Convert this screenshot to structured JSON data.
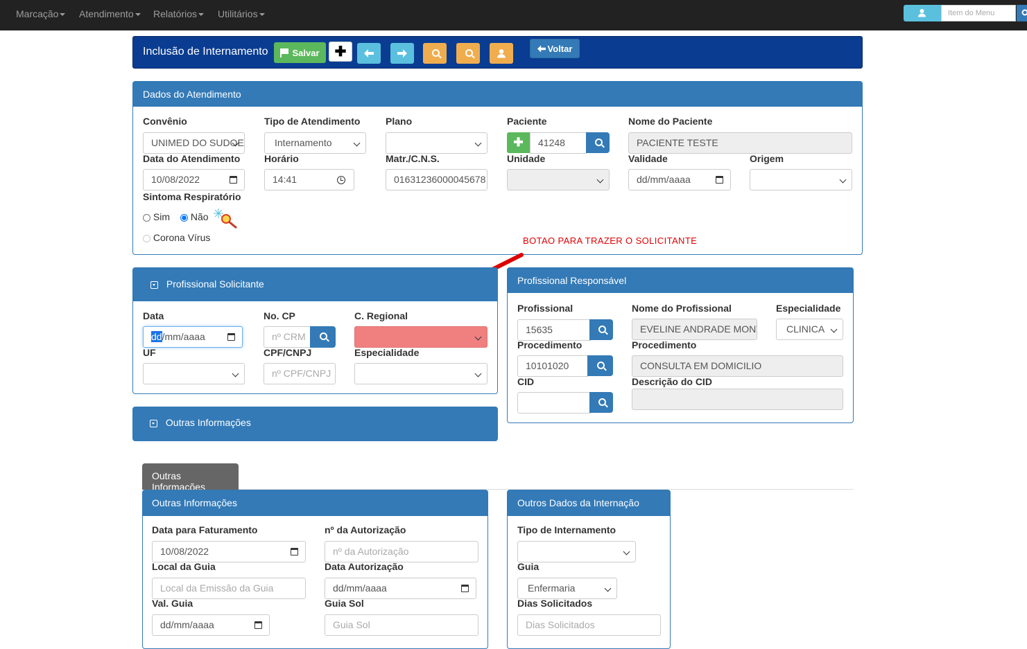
{
  "nav": {
    "items": [
      "Marcação",
      "Atendimento",
      "Relatórios",
      "Utilitários"
    ],
    "search_placeholder": "Item do Menu"
  },
  "toolbar": {
    "title": "Inclusão de Internamento",
    "save_label": "Salvar",
    "back_label": "Voltar"
  },
  "atendimento": {
    "header": "Dados do Atendimento",
    "convenio_label": "Convênio",
    "convenio_value": "UNIMED DO SUDOESTE",
    "tipo_label": "Tipo de Atendimento",
    "tipo_value": "Internamento",
    "plano_label": "Plano",
    "plano_value": "",
    "paciente_label": "Paciente",
    "paciente_value": "41248",
    "nome_label": "Nome do Paciente",
    "nome_value": "PACIENTE TESTE",
    "data_label": "Data do Atendimento",
    "data_value": "10/08/2022",
    "horario_label": "Horário",
    "horario_value": "14:41",
    "matr_label": "Matr./C.N.S.",
    "matr_value": "01631236000045678",
    "unidade_label": "Unidade",
    "validade_label": "Validade",
    "validade_value": "dd/mm/aaaa",
    "origem_label": "Origem",
    "sintoma_label": "Sintoma Respiratório",
    "sim_label": "Sim",
    "nao_label": "Não",
    "corona_label": "Corona Vírus"
  },
  "annotation": "BOTAO PARA TRAZER O SOLICITANTE",
  "solicitante": {
    "header": "Profissional Solicitante",
    "data_label": "Data",
    "data_value_dd": "dd",
    "data_value_rest": "/mm/aaaa",
    "cp_label": "No. CP",
    "cp_placeholder": "nº CRM",
    "regional_label": "C. Regional",
    "uf_label": "UF",
    "cpf_label": "CPF/CNPJ",
    "cpf_placeholder": "nº CPF/CNPJ",
    "esp_label": "Especialidade"
  },
  "outras_collapsed": {
    "header": "Outras Informações"
  },
  "responsavel": {
    "header": "Profissional Responsável",
    "prof_label": "Profissional",
    "prof_value": "15635",
    "nome_label": "Nome do Profissional",
    "nome_value": "EVELINE ANDRADE MONTEIRO",
    "esp_label": "Especialidade",
    "esp_value": "CLINICA",
    "proc_label": "Procedimento",
    "proc_value": "10101020",
    "proc_desc_label": "Procedimento",
    "proc_desc_value": "CONSULTA EM DOMICILIO",
    "cid_label": "CID",
    "cid_value": "",
    "cid_desc_label": "Descrição do CID"
  },
  "tab": {
    "label": "Outras Informações"
  },
  "outras": {
    "header": "Outras Informações",
    "fat_label": "Data para Faturamento",
    "fat_value": "10/08/2022",
    "aut_label": "nº da Autorização",
    "aut_placeholder": "nº da Autorização",
    "local_label": "Local da Guia",
    "local_placeholder": "Local da Emissão da Guia",
    "data_aut_label": "Data Autorização",
    "data_aut_value": "dd/mm/aaaa",
    "val_label": "Val. Guia",
    "val_value": "dd/mm/aaaa",
    "guia_sol_label": "Guia Sol",
    "guia_sol_placeholder": "Guia Sol"
  },
  "internacao": {
    "header": "Outros Dados da Internação",
    "tipo_label": "Tipo de Internamento",
    "guia_label": "Guia",
    "guia_value": "Enfermaria",
    "dias_label": "Dias Solicitados",
    "dias_placeholder": "Dias Solicitados"
  },
  "colors": {
    "primary": "#337ab7",
    "navy": "#0a3d91",
    "success": "#5cb85c",
    "info": "#5bc0de",
    "warning": "#f0ad4e",
    "danger_field": "#f08080",
    "annotation": "#e00000"
  }
}
